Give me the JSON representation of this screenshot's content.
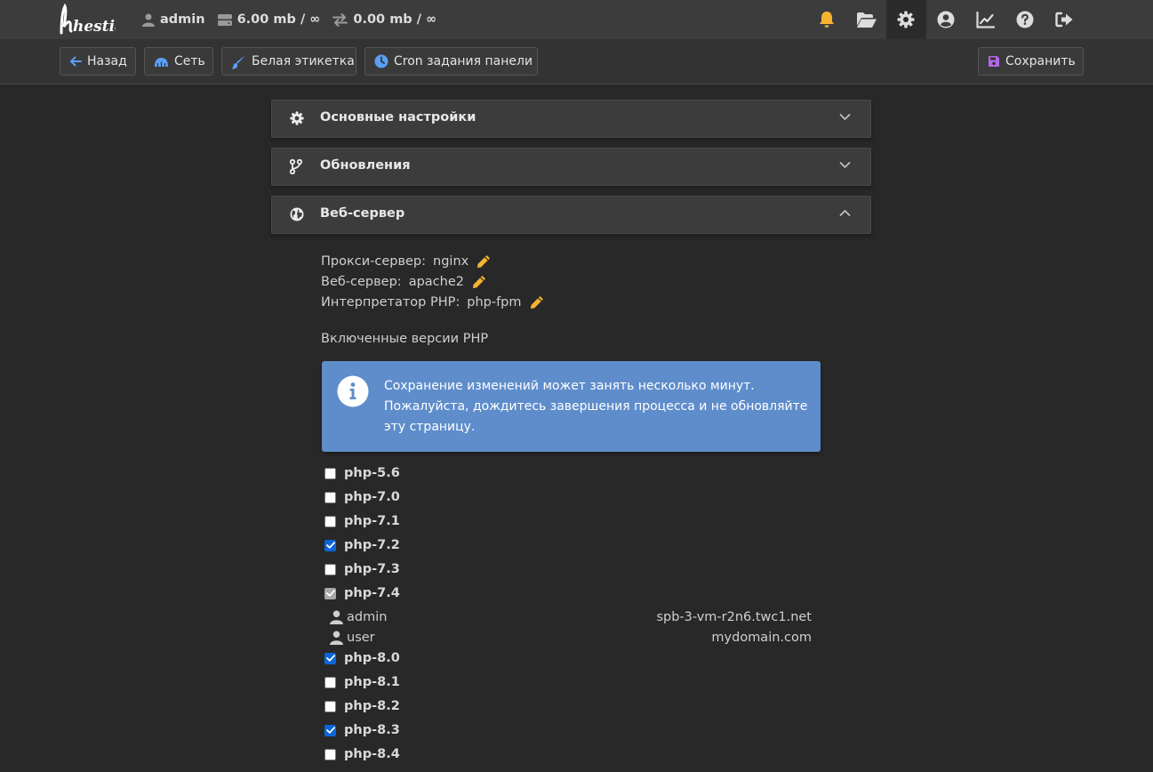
{
  "brand": {
    "logo_text": "hestia"
  },
  "topbar": {
    "user": "admin",
    "disk": "6.00 mb / ∞",
    "bandwidth": "0.00 mb / ∞",
    "icons": [
      "bell-icon",
      "folder-open-icon",
      "gear-icon",
      "user-circle-icon",
      "chart-line-icon",
      "question-circle-icon",
      "logout-icon"
    ],
    "active_icon": "gear-icon",
    "bell_color": "#f5b330"
  },
  "toolbar": {
    "back_label": "Назад",
    "network_label": "Сеть",
    "white_label_label": "Белая этикетка",
    "cron_label": "Cron задания панели",
    "save_label": "Сохранить",
    "save_icon_color": "#b566e8",
    "accent_color": "#5aa0f5"
  },
  "sections": [
    {
      "title": "Основные настройки",
      "icon": "gear-icon",
      "expanded": false
    },
    {
      "title": "Обновления",
      "icon": "code-branch-icon",
      "expanded": false
    },
    {
      "title": "Веб-сервер",
      "icon": "globe-icon",
      "expanded": true
    }
  ],
  "webserver": {
    "proxy_label": "Прокси-сервер:",
    "proxy_value": "nginx",
    "web_label": "Веб-сервер:",
    "web_value": "apache2",
    "php_label": "Интерпретатор PHP:",
    "php_value": "php-fpm",
    "edit_icon_color": "#f5b330",
    "php_versions_heading": "Включенные версии PHP"
  },
  "alert": {
    "text": "Сохранение изменений может занять несколько минут. Пожалуйста, дождитесь завершения процесса и не обновляйте эту страницу.",
    "color": "#5f8dcb"
  },
  "php_versions": [
    {
      "label": "php-5.6",
      "checked": false,
      "disabled": false
    },
    {
      "label": "php-7.0",
      "checked": false,
      "disabled": false
    },
    {
      "label": "php-7.1",
      "checked": false,
      "disabled": false
    },
    {
      "label": "php-7.2",
      "checked": true,
      "disabled": false
    },
    {
      "label": "php-7.3",
      "checked": false,
      "disabled": false
    },
    {
      "label": "php-7.4",
      "checked": true,
      "disabled": true,
      "users": [
        {
          "user": "admin",
          "domain": "spb-3-vm-r2n6.twc1.net"
        },
        {
          "user": "user",
          "domain": "mydomain.com"
        }
      ]
    },
    {
      "label": "php-8.0",
      "checked": true,
      "disabled": false
    },
    {
      "label": "php-8.1",
      "checked": false,
      "disabled": false
    },
    {
      "label": "php-8.2",
      "checked": false,
      "disabled": false
    },
    {
      "label": "php-8.3",
      "checked": true,
      "disabled": false
    },
    {
      "label": "php-8.4",
      "checked": false,
      "disabled": false
    }
  ]
}
